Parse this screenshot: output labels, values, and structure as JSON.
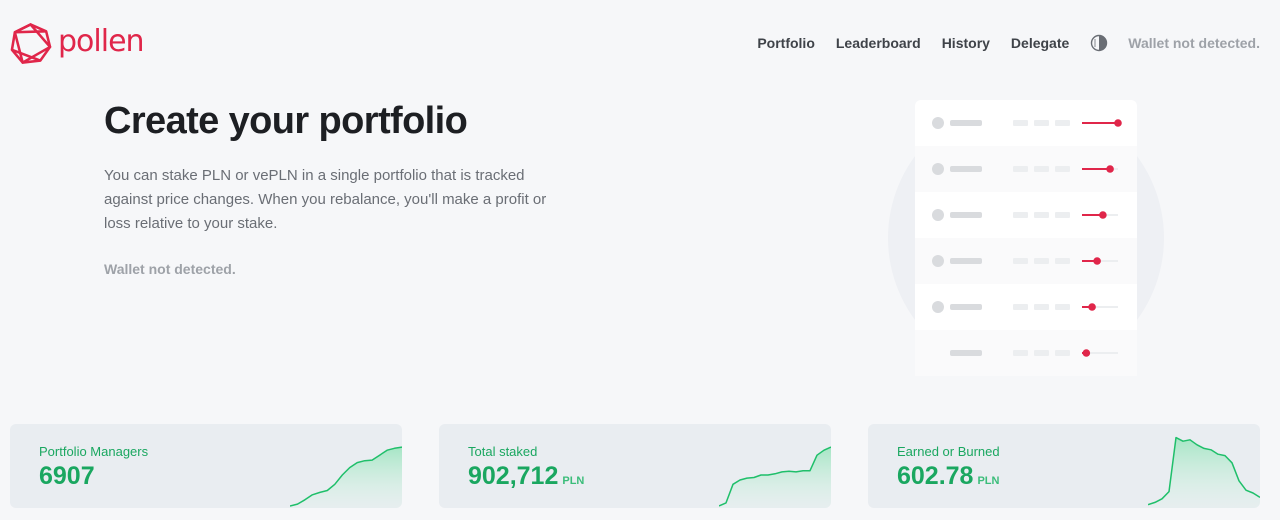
{
  "brand": {
    "name": "pollen"
  },
  "colors": {
    "brand": "#e0264a",
    "accent_green": "#1aa760",
    "background": "#f6f7f9"
  },
  "nav": {
    "items": [
      {
        "label": "Portfolio"
      },
      {
        "label": "Leaderboard"
      },
      {
        "label": "History"
      },
      {
        "label": "Delegate"
      }
    ],
    "theme_toggle_icon": "contrast-icon",
    "wallet_status": "Wallet not detected."
  },
  "hero": {
    "title": "Create your portfolio",
    "description": "You can stake PLN or vePLN in a single portfolio that is tracked against price changes. When you rebalance, you'll make a profit or loss relative to your stake.",
    "wallet_status": "Wallet not detected."
  },
  "illustration": {
    "slider_levels": [
      1.0,
      0.78,
      0.58,
      0.42,
      0.28,
      0.12
    ]
  },
  "stats": [
    {
      "label": "Portfolio Managers",
      "value": "6907",
      "unit": "",
      "trend": [
        0,
        0.03,
        0.1,
        0.18,
        0.22,
        0.25,
        0.35,
        0.5,
        0.62,
        0.7,
        0.73,
        0.74,
        0.82,
        0.9,
        0.93,
        0.95
      ]
    },
    {
      "label": "Total staked",
      "value": "902,712",
      "unit": "PLN",
      "trend": [
        0,
        0.05,
        0.35,
        0.42,
        0.45,
        0.46,
        0.5,
        0.5,
        0.52,
        0.55,
        0.56,
        0.55,
        0.57,
        0.57,
        0.82,
        0.9,
        0.95
      ]
    },
    {
      "label": "Earned or Burned",
      "value": "602.78",
      "unit": "PLN",
      "trend": [
        0.02,
        0.05,
        0.1,
        0.2,
        0.95,
        0.9,
        0.92,
        0.85,
        0.8,
        0.78,
        0.72,
        0.7,
        0.6,
        0.35,
        0.22,
        0.18,
        0.12
      ]
    }
  ]
}
